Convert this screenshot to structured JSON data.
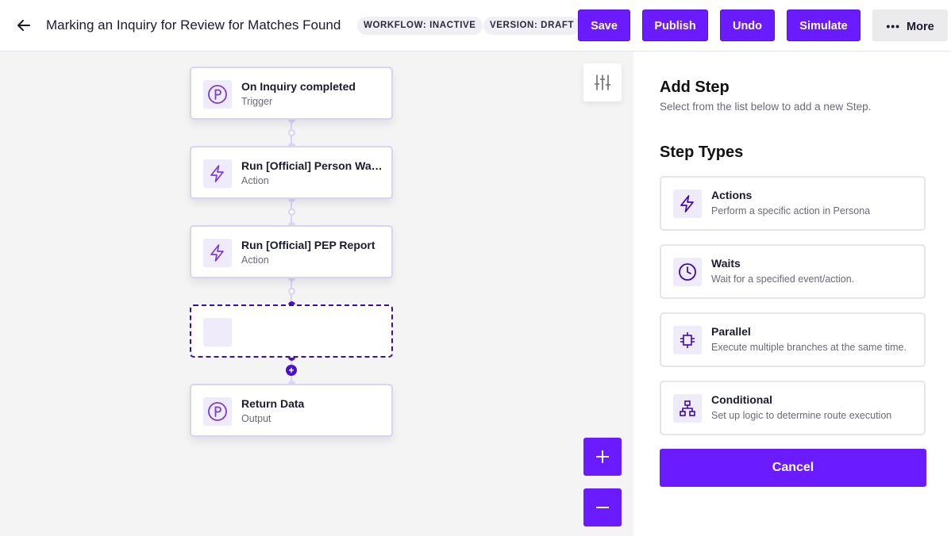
{
  "header": {
    "title": "Marking an Inquiry for Review for Matches Found",
    "workflow_status": "WORKFLOW: INACTIVE",
    "version_status": "VERSION: DRAFT",
    "save_label": "Save",
    "publish_label": "Publish",
    "undo_label": "Undo",
    "simulate_label": "Simulate",
    "more_label": "More"
  },
  "canvas": {
    "nodes": [
      {
        "title": "On Inquiry completed",
        "subtitle": "Trigger",
        "icon": "persona-logo-icon"
      },
      {
        "title": "Run [Official] Person Watchlist Report",
        "subtitle": "Action",
        "icon": "lightning-icon"
      },
      {
        "title": "Run [Official] PEP Report",
        "subtitle": "Action",
        "icon": "lightning-icon"
      },
      {
        "title": "",
        "subtitle": "",
        "icon": ""
      },
      {
        "title": "Return Data",
        "subtitle": "Output",
        "icon": "persona-logo-icon"
      }
    ]
  },
  "panel": {
    "title": "Add Step",
    "subtitle": "Select from the list below to add a new Step.",
    "section_title": "Step Types",
    "step_types": [
      {
        "title": "Actions",
        "description": "Perform a specific action in Persona",
        "icon": "lightning-icon"
      },
      {
        "title": "Waits",
        "description": "Wait for a specified event/action.",
        "icon": "clock-icon"
      },
      {
        "title": "Parallel",
        "description": "Execute multiple branches at the same time.",
        "icon": "parallel-icon"
      },
      {
        "title": "Conditional",
        "description": "Set up logic to determine route execution",
        "icon": "conditional-icon"
      }
    ],
    "cancel_label": "Cancel"
  },
  "colors": {
    "accent": "#6b1bff",
    "accent_dark": "#4a0fd1",
    "icon_bg": "#efebfb",
    "canvas_bg": "#f4f4f5"
  }
}
